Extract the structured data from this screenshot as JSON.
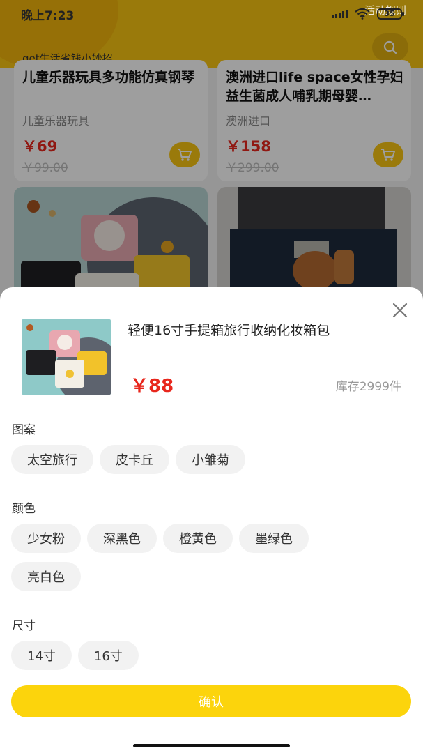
{
  "status_bar": {
    "time": "晚上7:23",
    "battery": "35"
  },
  "header": {
    "rules_link": "活动规则",
    "slogan": "get生活省钱小妙招",
    "search_icon": "search-icon"
  },
  "products": [
    {
      "name": "儿童乐器玩具多功能仿真钢琴",
      "category": "儿童乐器玩具",
      "price": "￥69",
      "original_price": "￥99.00"
    },
    {
      "name": "澳洲进口life space女性孕妇益生菌成人哺乳期母婴…",
      "category": "澳洲进口",
      "price": "￥158",
      "original_price": "￥299.00"
    }
  ],
  "sheet": {
    "title": "轻便16寸手提箱旅行收纳化妆箱包",
    "price": "￥88",
    "stock": "库存2999件",
    "options": [
      {
        "label": "图案",
        "values": [
          "太空旅行",
          "皮卡丘",
          "小雏菊"
        ]
      },
      {
        "label": "颜色",
        "values": [
          "少女粉",
          "深黑色",
          "橙黄色",
          "墨绿色",
          "亮白色"
        ]
      },
      {
        "label": "尺寸",
        "values": [
          "14寸",
          "16寸"
        ]
      }
    ],
    "confirm": "确认"
  },
  "colors": {
    "brand_yellow": "#f8c613",
    "price_red": "#e8271d",
    "confirm_yellow": "#fcd40c"
  }
}
